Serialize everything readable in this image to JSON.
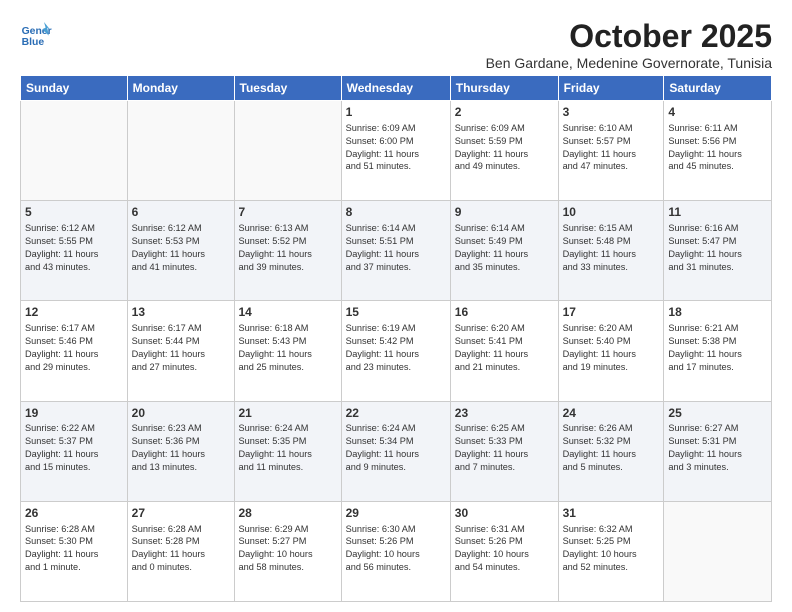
{
  "logo": {
    "line1": "General",
    "line2": "Blue"
  },
  "title": "October 2025",
  "subtitle": "Ben Gardane, Medenine Governorate, Tunisia",
  "headers": [
    "Sunday",
    "Monday",
    "Tuesday",
    "Wednesday",
    "Thursday",
    "Friday",
    "Saturday"
  ],
  "weeks": [
    [
      {
        "day": "",
        "info": ""
      },
      {
        "day": "",
        "info": ""
      },
      {
        "day": "",
        "info": ""
      },
      {
        "day": "1",
        "info": "Sunrise: 6:09 AM\nSunset: 6:00 PM\nDaylight: 11 hours\nand 51 minutes."
      },
      {
        "day": "2",
        "info": "Sunrise: 6:09 AM\nSunset: 5:59 PM\nDaylight: 11 hours\nand 49 minutes."
      },
      {
        "day": "3",
        "info": "Sunrise: 6:10 AM\nSunset: 5:57 PM\nDaylight: 11 hours\nand 47 minutes."
      },
      {
        "day": "4",
        "info": "Sunrise: 6:11 AM\nSunset: 5:56 PM\nDaylight: 11 hours\nand 45 minutes."
      }
    ],
    [
      {
        "day": "5",
        "info": "Sunrise: 6:12 AM\nSunset: 5:55 PM\nDaylight: 11 hours\nand 43 minutes."
      },
      {
        "day": "6",
        "info": "Sunrise: 6:12 AM\nSunset: 5:53 PM\nDaylight: 11 hours\nand 41 minutes."
      },
      {
        "day": "7",
        "info": "Sunrise: 6:13 AM\nSunset: 5:52 PM\nDaylight: 11 hours\nand 39 minutes."
      },
      {
        "day": "8",
        "info": "Sunrise: 6:14 AM\nSunset: 5:51 PM\nDaylight: 11 hours\nand 37 minutes."
      },
      {
        "day": "9",
        "info": "Sunrise: 6:14 AM\nSunset: 5:49 PM\nDaylight: 11 hours\nand 35 minutes."
      },
      {
        "day": "10",
        "info": "Sunrise: 6:15 AM\nSunset: 5:48 PM\nDaylight: 11 hours\nand 33 minutes."
      },
      {
        "day": "11",
        "info": "Sunrise: 6:16 AM\nSunset: 5:47 PM\nDaylight: 11 hours\nand 31 minutes."
      }
    ],
    [
      {
        "day": "12",
        "info": "Sunrise: 6:17 AM\nSunset: 5:46 PM\nDaylight: 11 hours\nand 29 minutes."
      },
      {
        "day": "13",
        "info": "Sunrise: 6:17 AM\nSunset: 5:44 PM\nDaylight: 11 hours\nand 27 minutes."
      },
      {
        "day": "14",
        "info": "Sunrise: 6:18 AM\nSunset: 5:43 PM\nDaylight: 11 hours\nand 25 minutes."
      },
      {
        "day": "15",
        "info": "Sunrise: 6:19 AM\nSunset: 5:42 PM\nDaylight: 11 hours\nand 23 minutes."
      },
      {
        "day": "16",
        "info": "Sunrise: 6:20 AM\nSunset: 5:41 PM\nDaylight: 11 hours\nand 21 minutes."
      },
      {
        "day": "17",
        "info": "Sunrise: 6:20 AM\nSunset: 5:40 PM\nDaylight: 11 hours\nand 19 minutes."
      },
      {
        "day": "18",
        "info": "Sunrise: 6:21 AM\nSunset: 5:38 PM\nDaylight: 11 hours\nand 17 minutes."
      }
    ],
    [
      {
        "day": "19",
        "info": "Sunrise: 6:22 AM\nSunset: 5:37 PM\nDaylight: 11 hours\nand 15 minutes."
      },
      {
        "day": "20",
        "info": "Sunrise: 6:23 AM\nSunset: 5:36 PM\nDaylight: 11 hours\nand 13 minutes."
      },
      {
        "day": "21",
        "info": "Sunrise: 6:24 AM\nSunset: 5:35 PM\nDaylight: 11 hours\nand 11 minutes."
      },
      {
        "day": "22",
        "info": "Sunrise: 6:24 AM\nSunset: 5:34 PM\nDaylight: 11 hours\nand 9 minutes."
      },
      {
        "day": "23",
        "info": "Sunrise: 6:25 AM\nSunset: 5:33 PM\nDaylight: 11 hours\nand 7 minutes."
      },
      {
        "day": "24",
        "info": "Sunrise: 6:26 AM\nSunset: 5:32 PM\nDaylight: 11 hours\nand 5 minutes."
      },
      {
        "day": "25",
        "info": "Sunrise: 6:27 AM\nSunset: 5:31 PM\nDaylight: 11 hours\nand 3 minutes."
      }
    ],
    [
      {
        "day": "26",
        "info": "Sunrise: 6:28 AM\nSunset: 5:30 PM\nDaylight: 11 hours\nand 1 minute."
      },
      {
        "day": "27",
        "info": "Sunrise: 6:28 AM\nSunset: 5:28 PM\nDaylight: 11 hours\nand 0 minutes."
      },
      {
        "day": "28",
        "info": "Sunrise: 6:29 AM\nSunset: 5:27 PM\nDaylight: 10 hours\nand 58 minutes."
      },
      {
        "day": "29",
        "info": "Sunrise: 6:30 AM\nSunset: 5:26 PM\nDaylight: 10 hours\nand 56 minutes."
      },
      {
        "day": "30",
        "info": "Sunrise: 6:31 AM\nSunset: 5:26 PM\nDaylight: 10 hours\nand 54 minutes."
      },
      {
        "day": "31",
        "info": "Sunrise: 6:32 AM\nSunset: 5:25 PM\nDaylight: 10 hours\nand 52 minutes."
      },
      {
        "day": "",
        "info": ""
      }
    ]
  ]
}
